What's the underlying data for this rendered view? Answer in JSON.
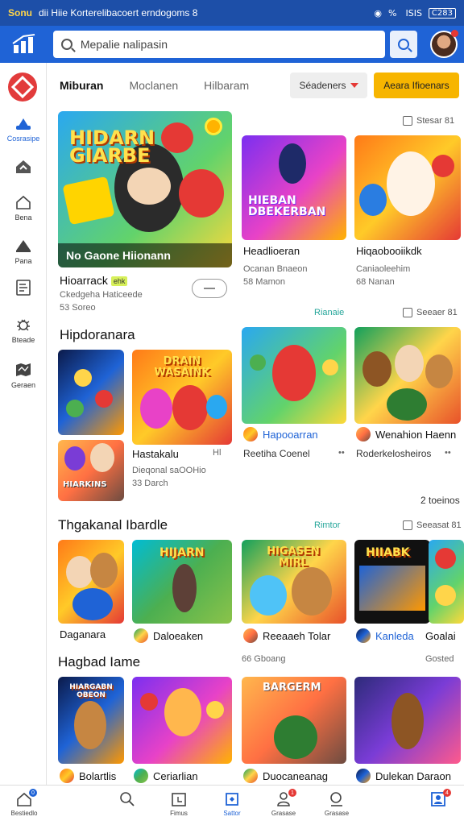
{
  "status": {
    "carrier": "Sonu",
    "text": "dii Hiie Korterelibacoert erndogoms 8",
    "signal": "%  ISIS",
    "battery": "C283"
  },
  "search": {
    "placeholder": "Mepalie nalipasin"
  },
  "sidebar": {
    "items": [
      {
        "label": "Cosrasipe",
        "icon": "controller-icon"
      },
      {
        "label": "",
        "icon": "home-icon"
      },
      {
        "label": "Bena",
        "icon": "house-outline-icon"
      },
      {
        "label": "Pana",
        "icon": "triangle-up-icon"
      },
      {
        "label": "",
        "icon": "document-icon"
      },
      {
        "label": "Bteade",
        "icon": "bug-icon"
      },
      {
        "label": "Geraen",
        "icon": "map-icon"
      }
    ]
  },
  "tabs": [
    "Miburan",
    "Moclanen",
    "Hilbaram"
  ],
  "sort_label": "Séadeners",
  "add_label": "Aeara Ifioenars",
  "featured": {
    "check_label": "Stesar 81",
    "hero_title": "HIDARN GIARBE",
    "hero_caption": "No Gaone Hiionann",
    "hero_name": "Hioarrack",
    "hero_badge": "ehk",
    "hero_sub1": "Ckedgeha Haticeede",
    "hero_sub2": "53 Soreo",
    "cards": [
      {
        "art": "HIEBAN DBEKERBAN",
        "title": "Headlioeran",
        "sub1": "Ocanan Bnaeon",
        "sub2": "58 Mamon"
      },
      {
        "art": "",
        "title": "Hiqaobooiikdk",
        "sub1": "Caniaoleehim",
        "sub2": "68 Nanan"
      }
    ],
    "link": "Rianaie",
    "check2": "Seeaer 81"
  },
  "sec2": {
    "title": "Hipdoranara",
    "left_a": "",
    "left_b_art": "HIARKINS",
    "center_art": "DRAIN WASAINK",
    "center_title": "Hastakalu",
    "center_tag": "Hl",
    "center_sub1": "Dieqonal saOOHio",
    "center_sub2": "33 Darch",
    "cards": [
      {
        "title": "Hapooarran",
        "sub1": "Reetiha Coenel",
        "sub2": "",
        "dots": "••"
      },
      {
        "title": "Wenahion Haenn",
        "sub1": "Roderkelosheiros",
        "sub2": "",
        "dots": "••"
      }
    ],
    "count": "2 toeinos"
  },
  "sec3": {
    "title": "Thgakanal Ibardle",
    "link": "Rimtor",
    "check": "Seeasat 81",
    "cards": [
      {
        "art": "",
        "title": "Daganara"
      },
      {
        "art": "HIJARN",
        "title": "Daloeaken"
      },
      {
        "art": "HIGASEN MIRL",
        "title": "Reeaaeh Tolar"
      },
      {
        "art": "HIIABK",
        "title": "Kanleda"
      },
      {
        "art": "",
        "title": "Goalai"
      }
    ]
  },
  "sec4": {
    "title": "Hagbad Iame",
    "sub": "66 Gboang",
    "right": "Gosted",
    "cards": [
      {
        "art": "HIARGABN OBEON",
        "title": "Bolartlis"
      },
      {
        "art": "",
        "title": "Ceriarlian"
      },
      {
        "art": "BARGERM",
        "title": "Duocaneanag"
      },
      {
        "art": "",
        "title": "Dulekan Daraon"
      }
    ]
  },
  "bottom_nav": [
    {
      "label": "Bestiedlo",
      "icon": "home-icon",
      "badge": "0"
    },
    {
      "label": "",
      "icon": "search-icon",
      "badge": ""
    },
    {
      "label": "Fimus",
      "icon": "calendar-icon",
      "badge": ""
    },
    {
      "label": "Sattor",
      "icon": "shield-icon",
      "badge": ""
    },
    {
      "label": "Grasase",
      "icon": "bell-icon",
      "badge": "1"
    },
    {
      "label": "Grasase",
      "icon": "search-icon",
      "badge": ""
    },
    {
      "label": "",
      "icon": "profile-card-icon",
      "badge": "4"
    }
  ],
  "colors": {
    "primary": "#1f63d6",
    "accent": "#f7b500",
    "link": "#26a69a",
    "brand_red": "#e23b3b"
  }
}
